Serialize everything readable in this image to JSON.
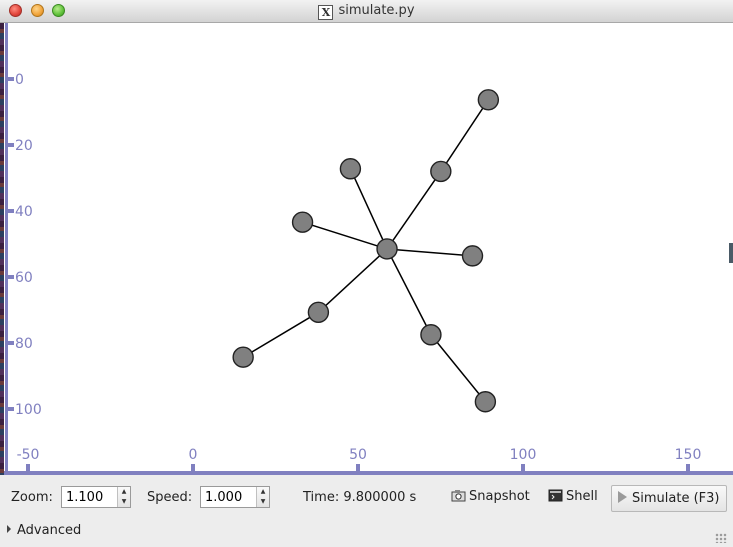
{
  "window": {
    "title": "simulate.py",
    "title_icon": "x11-icon"
  },
  "canvas": {
    "background": "#ffffff",
    "axis_color": "#8080c0",
    "node_fill": "#808080",
    "node_stroke": "#222222",
    "edge_color": "#000000",
    "x_axis": {
      "min": -55,
      "max": 165,
      "ticks": [
        -50,
        0,
        50,
        100,
        150
      ]
    },
    "y_axis": {
      "min": -16,
      "max": 118,
      "ticks": [
        0,
        20,
        40,
        60,
        80,
        100
      ]
    },
    "nodes": [
      {
        "id": "center",
        "x": 58.8,
        "y": 51.5
      },
      {
        "id": "n1",
        "x": 47.7,
        "y": 27.2
      },
      {
        "id": "n2",
        "x": 75.1,
        "y": 28.0
      },
      {
        "id": "n3",
        "x": 89.5,
        "y": 6.3
      },
      {
        "id": "n4",
        "x": 33.2,
        "y": 43.4
      },
      {
        "id": "n5",
        "x": 84.7,
        "y": 53.6
      },
      {
        "id": "n6",
        "x": 38.0,
        "y": 70.7
      },
      {
        "id": "n7",
        "x": 15.2,
        "y": 84.3
      },
      {
        "id": "n8",
        "x": 72.1,
        "y": 77.5
      },
      {
        "id": "n9",
        "x": 88.6,
        "y": 97.8
      }
    ],
    "edges": [
      [
        "center",
        "n1"
      ],
      [
        "center",
        "n2"
      ],
      [
        "n2",
        "n3"
      ],
      [
        "center",
        "n4"
      ],
      [
        "center",
        "n5"
      ],
      [
        "center",
        "n6"
      ],
      [
        "n6",
        "n7"
      ],
      [
        "center",
        "n8"
      ],
      [
        "n8",
        "n9"
      ]
    ]
  },
  "controls": {
    "zoom_label": "Zoom:",
    "zoom_value": "1.100",
    "speed_label": "Speed:",
    "speed_value": "1.000",
    "time_text": "Time: 9.800000 s",
    "snapshot_label": "Snapshot",
    "shell_label": "Shell",
    "simulate_label": "Simulate (F3)",
    "advanced_label": "Advanced"
  }
}
